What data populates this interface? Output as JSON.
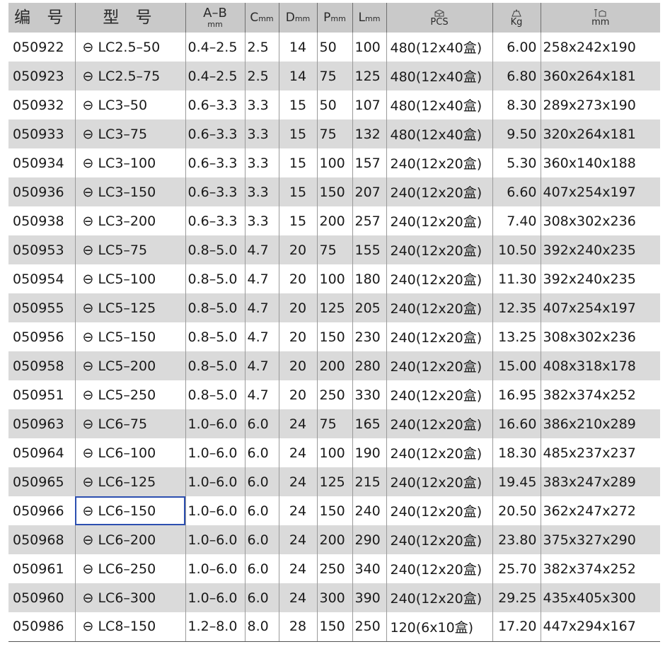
{
  "headers": {
    "code": "编 号",
    "model": "型 号",
    "ab": {
      "main": "A–B",
      "sub": "mm"
    },
    "c": {
      "main": "C",
      "sub": "mm"
    },
    "d": {
      "main": "D",
      "sub": "mm"
    },
    "p": {
      "main": "P",
      "sub": "mm"
    },
    "l": {
      "main": "L",
      "sub": "mm"
    },
    "pcs": {
      "icon": "carton-box-icon",
      "label": "PCS"
    },
    "kg": {
      "icon": "weight-scale-icon",
      "label": "Kg"
    },
    "size": {
      "icon": "box-dimension-icon",
      "label": "mm"
    }
  },
  "model_prefix": "⊖",
  "selected_row": 16,
  "rows": [
    {
      "code": "050922",
      "model": "LC2.5–50",
      "ab": "0.4–2.5",
      "c": "2.5",
      "d": "14",
      "p": "50",
      "l": "100",
      "pcs": "480(12x40盒)",
      "kg": "6.00",
      "size": "258x242x190"
    },
    {
      "code": "050923",
      "model": "LC2.5–75",
      "ab": "0.4–2.5",
      "c": "2.5",
      "d": "14",
      "p": "75",
      "l": "125",
      "pcs": "480(12x40盒)",
      "kg": "6.80",
      "size": "360x264x181"
    },
    {
      "code": "050932",
      "model": "LC3–50",
      "ab": "0.6–3.3",
      "c": "3.3",
      "d": "15",
      "p": "50",
      "l": "107",
      "pcs": "480(12x40盒)",
      "kg": "8.30",
      "size": "289x273x190"
    },
    {
      "code": "050933",
      "model": "LC3–75",
      "ab": "0.6–3.3",
      "c": "3.3",
      "d": "15",
      "p": "75",
      "l": "132",
      "pcs": "480(12x40盒)",
      "kg": "9.50",
      "size": "320x264x181"
    },
    {
      "code": "050934",
      "model": "LC3–100",
      "ab": "0.6–3.3",
      "c": "3.3",
      "d": "15",
      "p": "100",
      "l": "157",
      "pcs": "240(12x20盒)",
      "kg": "5.30",
      "size": "360x140x188"
    },
    {
      "code": "050936",
      "model": "LC3–150",
      "ab": "0.6–3.3",
      "c": "3.3",
      "d": "15",
      "p": "150",
      "l": "207",
      "pcs": "240(12x20盒)",
      "kg": "6.60",
      "size": "407x254x197"
    },
    {
      "code": "050938",
      "model": "LC3–200",
      "ab": "0.6–3.3",
      "c": "3.3",
      "d": "15",
      "p": "200",
      "l": "257",
      "pcs": "240(12x20盒)",
      "kg": "7.40",
      "size": "308x302x236"
    },
    {
      "code": "050953",
      "model": "LC5–75",
      "ab": "0.8–5.0",
      "c": "4.7",
      "d": "20",
      "p": "75",
      "l": "155",
      "pcs": "240(12x20盒)",
      "kg": "10.50",
      "size": "392x240x235"
    },
    {
      "code": "050954",
      "model": "LC5–100",
      "ab": "0.8–5.0",
      "c": "4.7",
      "d": "20",
      "p": "100",
      "l": "180",
      "pcs": "240(12x20盒)",
      "kg": "11.30",
      "size": "392x240x235"
    },
    {
      "code": "050955",
      "model": "LC5–125",
      "ab": "0.8–5.0",
      "c": "4.7",
      "d": "20",
      "p": "125",
      "l": "205",
      "pcs": "240(12x20盒)",
      "kg": "12.35",
      "size": "407x254x197"
    },
    {
      "code": "050956",
      "model": "LC5–150",
      "ab": "0.8–5.0",
      "c": "4.7",
      "d": "20",
      "p": "150",
      "l": "230",
      "pcs": "240(12x20盒)",
      "kg": "13.25",
      "size": "308x302x236"
    },
    {
      "code": "050958",
      "model": "LC5–200",
      "ab": "0.8–5.0",
      "c": "4.7",
      "d": "20",
      "p": "200",
      "l": "280",
      "pcs": "240(12x20盒)",
      "kg": "15.00",
      "size": "408x318x178"
    },
    {
      "code": "050951",
      "model": "LC5–250",
      "ab": "0.8–5.0",
      "c": "4.7",
      "d": "20",
      "p": "250",
      "l": "330",
      "pcs": "240(12x20盒)",
      "kg": "16.95",
      "size": "382x374x252"
    },
    {
      "code": "050963",
      "model": "LC6–75",
      "ab": "1.0–6.0",
      "c": "6.0",
      "d": "24",
      "p": "75",
      "l": "165",
      "pcs": "240(12x20盒)",
      "kg": "16.60",
      "size": "386x210x289"
    },
    {
      "code": "050964",
      "model": "LC6–100",
      "ab": "1.0–6.0",
      "c": "6.0",
      "d": "24",
      "p": "100",
      "l": "190",
      "pcs": "240(12x20盒)",
      "kg": "18.30",
      "size": "485x237x237"
    },
    {
      "code": "050965",
      "model": "LC6–125",
      "ab": "1.0–6.0",
      "c": "6.0",
      "d": "24",
      "p": "125",
      "l": "215",
      "pcs": "240(12x20盒)",
      "kg": "19.45",
      "size": "383x247x289"
    },
    {
      "code": "050966",
      "model": "LC6–150",
      "ab": "1.0–6.0",
      "c": "6.0",
      "d": "24",
      "p": "150",
      "l": "240",
      "pcs": "240(12x20盒)",
      "kg": "20.50",
      "size": "362x247x272"
    },
    {
      "code": "050968",
      "model": "LC6–200",
      "ab": "1.0–6.0",
      "c": "6.0",
      "d": "24",
      "p": "200",
      "l": "290",
      "pcs": "240(12x20盒)",
      "kg": "23.80",
      "size": "375x327x290"
    },
    {
      "code": "050961",
      "model": "LC6–250",
      "ab": "1.0–6.0",
      "c": "6.0",
      "d": "24",
      "p": "250",
      "l": "340",
      "pcs": "240(12x20盒)",
      "kg": "25.70",
      "size": "382x374x252"
    },
    {
      "code": "050960",
      "model": "LC6–300",
      "ab": "1.0–6.0",
      "c": "6.0",
      "d": "24",
      "p": "300",
      "l": "390",
      "pcs": "240(12x20盒)",
      "kg": "29.25",
      "size": "435x405x300"
    },
    {
      "code": "050986",
      "model": "LC8–150",
      "ab": "1.2–8.0",
      "c": "8.0",
      "d": "28",
      "p": "150",
      "l": "250",
      "pcs": "120(6x10盒)",
      "kg": "17.20",
      "size": "447x294x167"
    }
  ]
}
